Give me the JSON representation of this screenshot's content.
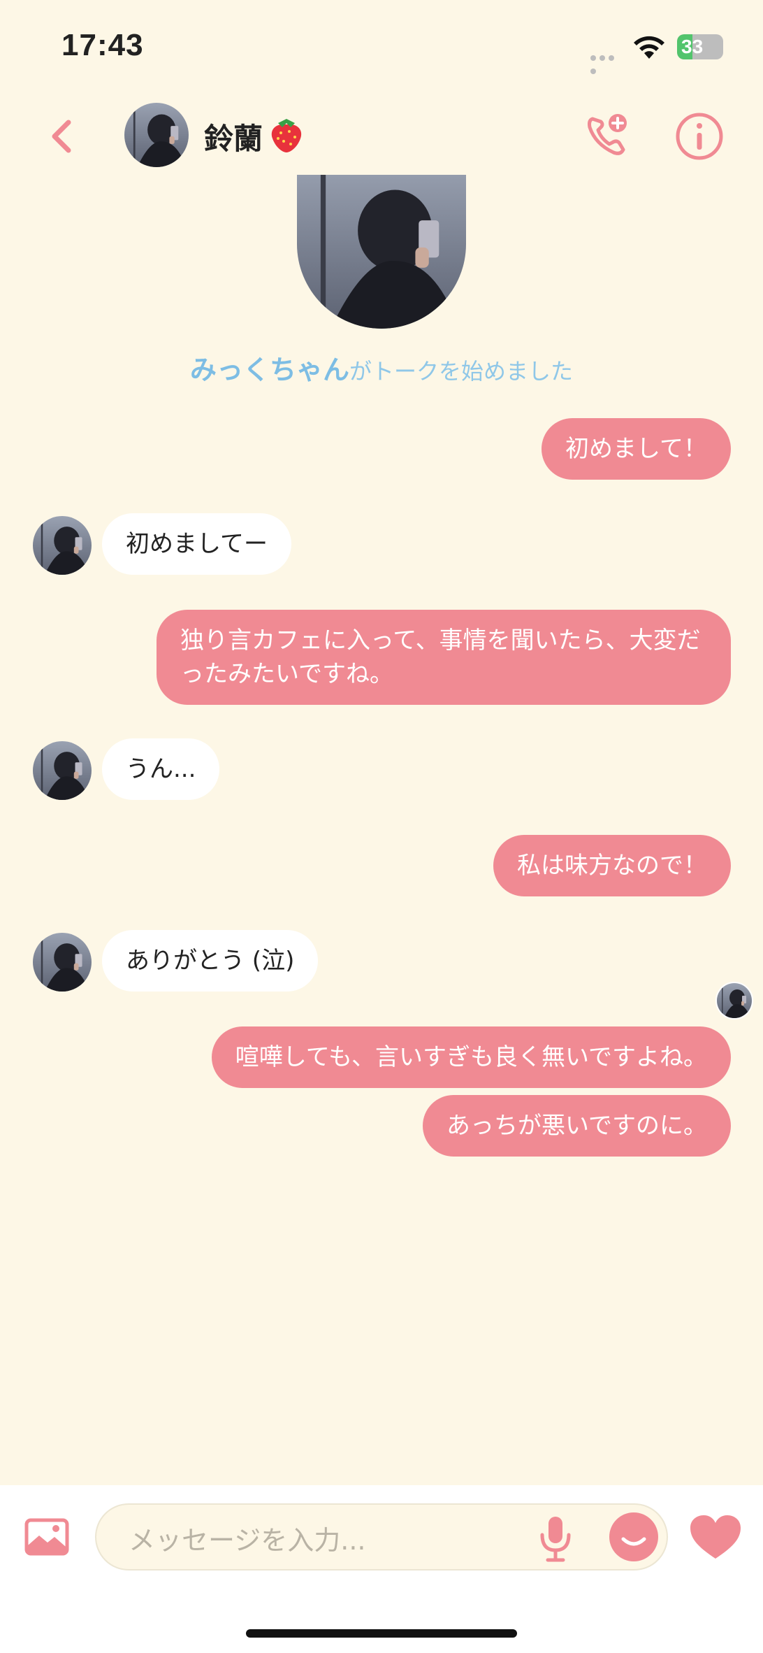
{
  "status": {
    "time": "17:43",
    "battery": "33",
    "battery_level": 0.33
  },
  "header": {
    "name": "鈴蘭",
    "back_icon": "chevron-left-icon",
    "call_icon": "phone-add-icon",
    "info_icon": "info-icon"
  },
  "intro": {
    "user": "みっくちゃん",
    "text": "がトークを始めました"
  },
  "messages": [
    {
      "dir": "out",
      "text": "初めまして！"
    },
    {
      "dir": "in",
      "text": "初めましてー"
    },
    {
      "dir": "out",
      "text": "独り言カフェに入って、事情を聞いたら、大変だったみたいですね。"
    },
    {
      "dir": "in",
      "text": "うん..."
    },
    {
      "dir": "out",
      "text": "私は味方なので！"
    },
    {
      "dir": "in",
      "text": "ありがとう (泣)"
    },
    {
      "dir": "out",
      "text": "喧嘩しても、言いすぎも良く無いですよね。"
    },
    {
      "dir": "out",
      "text": "あっちが悪いですのに。"
    }
  ],
  "composer": {
    "placeholder": "メッセージを入力..."
  },
  "colors": {
    "accent": "#f08a93",
    "background": "#fdf7e6",
    "link": "#7dbde4"
  }
}
